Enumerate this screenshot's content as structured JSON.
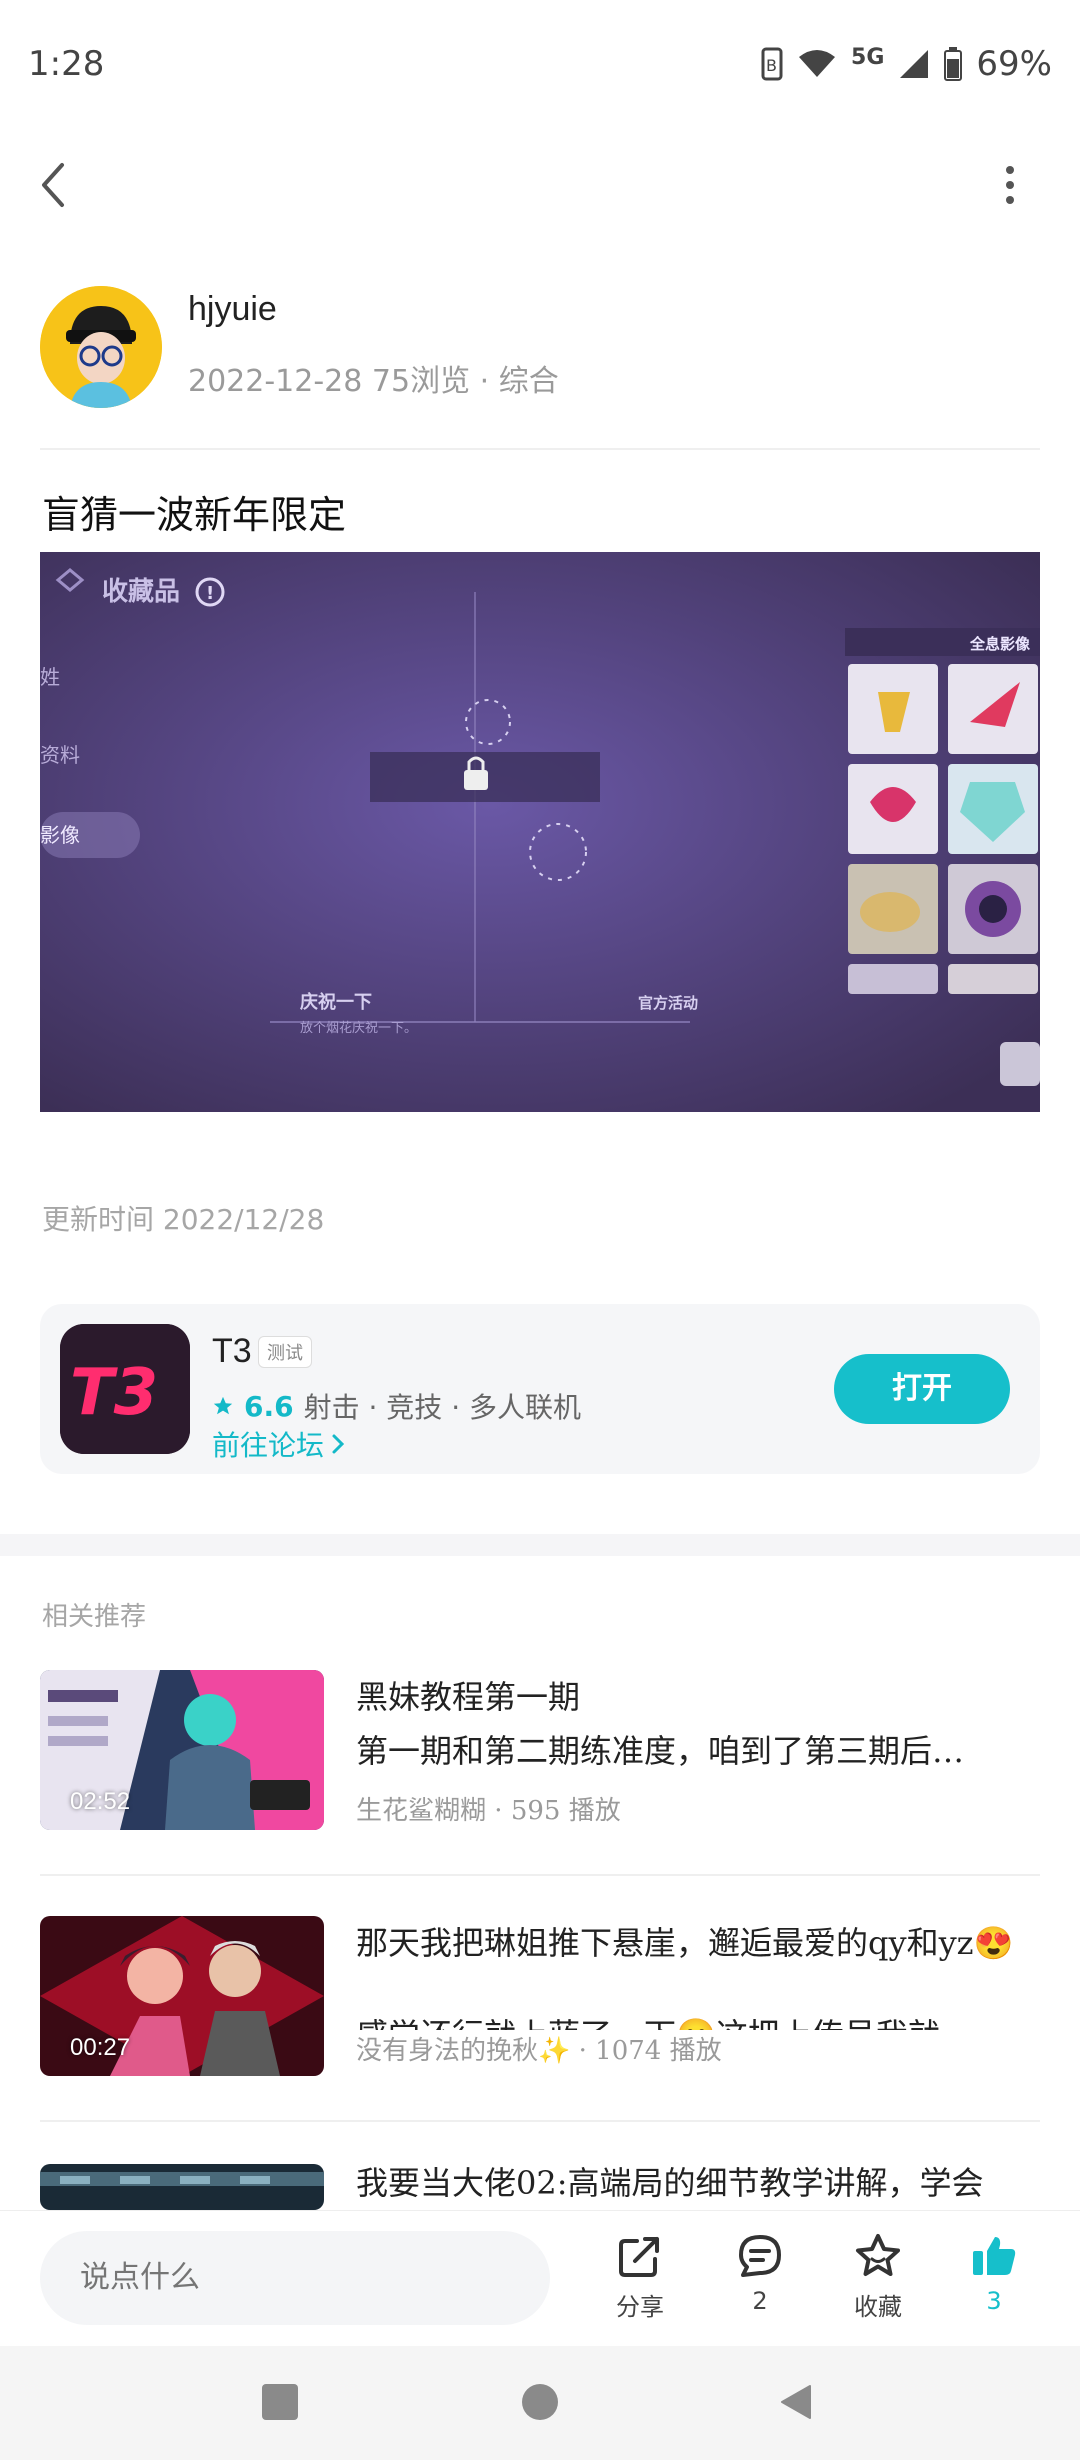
{
  "status": {
    "time": "1:28",
    "network": "5G",
    "battery": "69%"
  },
  "author": {
    "name": "hjyuie",
    "date": "2022-12-28",
    "views": "75浏览",
    "category": "综合",
    "meta_sep": "·"
  },
  "post": {
    "title": "盲猜一波新年限定",
    "image_texts": {
      "header": "收藏品",
      "tab_1": "姓",
      "tab_2": "资料",
      "tab_3": "影像",
      "panel_title": "全息影像",
      "item_title": "庆祝一下",
      "item_desc": "放个烟花庆祝一下。",
      "item_source": "官方活动"
    },
    "update_time": "更新时间 2022/12/28"
  },
  "app_card": {
    "name": "T3",
    "icon_text": "T3",
    "tag": "测试",
    "rating": "6.6",
    "genres": "射击 · 竞技 · 多人联机",
    "forum_link": "前往论坛",
    "open_label": "打开",
    "accent_color": "#16bfcb"
  },
  "recommendations": {
    "heading": "相关推荐",
    "items": [
      {
        "title": "黑妹教程第一期",
        "subtitle": "第一期和第二期练准度，咱到了第三期后…",
        "author": "生花鲨糊糊",
        "plays": "595 播放",
        "duration": "02:52"
      },
      {
        "title": "那天我把琳姐推下悬崖，邂逅最爱的qy和yz😍",
        "subtitle": "感觉还行就上蓝了，下😊这把上传号我就",
        "author": "没有身法的挽秋✨",
        "plays": "1074 播放",
        "duration": "00:27"
      },
      {
        "title": "我要当大佬02:高端局的细节教学讲解，学会"
      }
    ],
    "meta_sep": "·"
  },
  "bottom_bar": {
    "comment_placeholder": "说点什么",
    "share_label": "分享",
    "comment_count": "2",
    "favorite_label": "收藏",
    "like_count": "3"
  }
}
